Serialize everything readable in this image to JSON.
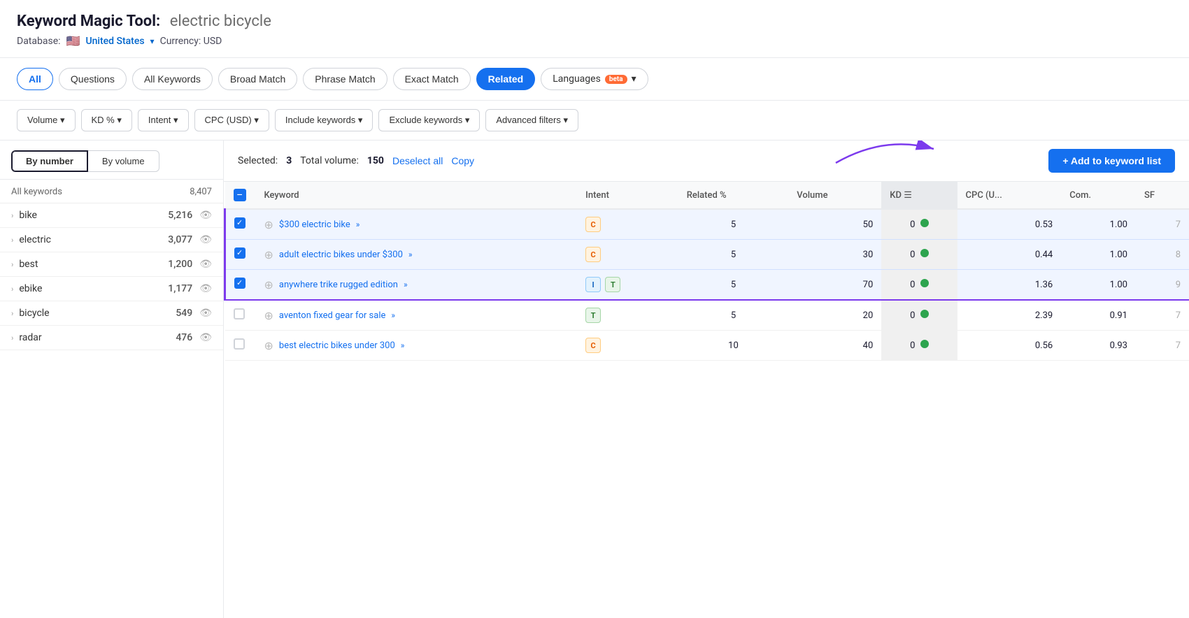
{
  "header": {
    "title_prefix": "Keyword Magic Tool:",
    "query": "electric bicycle",
    "database_label": "Database:",
    "flag": "🇺🇸",
    "country": "United States",
    "currency_label": "Currency: USD"
  },
  "tabs": [
    {
      "id": "all",
      "label": "All",
      "active": true
    },
    {
      "id": "questions",
      "label": "Questions",
      "active": false
    },
    {
      "id": "all-keywords",
      "label": "All Keywords",
      "active": false
    },
    {
      "id": "broad-match",
      "label": "Broad Match",
      "active": false
    },
    {
      "id": "phrase-match",
      "label": "Phrase Match",
      "active": false
    },
    {
      "id": "exact-match",
      "label": "Exact Match",
      "active": false
    },
    {
      "id": "related",
      "label": "Related",
      "active": false,
      "selected": true
    }
  ],
  "languages_label": "Languages",
  "filters": [
    {
      "id": "volume",
      "label": "Volume ▾"
    },
    {
      "id": "kd",
      "label": "KD % ▾"
    },
    {
      "id": "intent",
      "label": "Intent ▾"
    },
    {
      "id": "cpc",
      "label": "CPC (USD) ▾"
    },
    {
      "id": "include-keywords",
      "label": "Include keywords ▾"
    },
    {
      "id": "exclude-keywords",
      "label": "Exclude keywords ▾"
    },
    {
      "id": "advanced-filters",
      "label": "Advanced filters ▾"
    }
  ],
  "sidebar": {
    "sort_by_number": "By number",
    "sort_by_volume": "By volume",
    "all_keywords_label": "All keywords",
    "all_keywords_count": "8,407",
    "items": [
      {
        "keyword": "bike",
        "count": "5,216"
      },
      {
        "keyword": "electric",
        "count": "3,077"
      },
      {
        "keyword": "best",
        "count": "1,200"
      },
      {
        "keyword": "ebike",
        "count": "1,177"
      },
      {
        "keyword": "bicycle",
        "count": "549"
      },
      {
        "keyword": "radar",
        "count": "476"
      }
    ]
  },
  "selection_bar": {
    "selected_label": "Selected:",
    "selected_count": "3",
    "total_volume_label": "Total volume:",
    "total_volume": "150",
    "deselect_all": "Deselect all",
    "copy": "Copy",
    "add_button": "+ Add to keyword list"
  },
  "table": {
    "columns": [
      {
        "id": "checkbox",
        "label": ""
      },
      {
        "id": "keyword",
        "label": "Keyword"
      },
      {
        "id": "intent",
        "label": "Intent"
      },
      {
        "id": "related_pct",
        "label": "Related %"
      },
      {
        "id": "volume",
        "label": "Volume"
      },
      {
        "id": "kd",
        "label": "KD ☰",
        "sorted": true
      },
      {
        "id": "cpc",
        "label": "CPC (U..."
      },
      {
        "id": "com",
        "label": "Com."
      },
      {
        "id": "sf",
        "label": "SF"
      }
    ],
    "rows": [
      {
        "id": "row1",
        "selected": true,
        "keyword": "$300 electric bike",
        "intent": "C",
        "intent_type": "c",
        "related_pct": "5",
        "volume": "50",
        "kd": "0",
        "kd_dot": true,
        "cpc": "0.53",
        "com": "1.00",
        "sf": "7"
      },
      {
        "id": "row2",
        "selected": true,
        "keyword": "adult electric bikes under $300",
        "intent": "C",
        "intent_type": "c",
        "related_pct": "5",
        "volume": "30",
        "kd": "0",
        "kd_dot": true,
        "cpc": "0.44",
        "com": "1.00",
        "sf": "8"
      },
      {
        "id": "row3",
        "selected": true,
        "keyword": "anywhere trike rugged edition",
        "intent_badges": [
          "I",
          "T"
        ],
        "intent_types": [
          "i",
          "t"
        ],
        "related_pct": "5",
        "volume": "70",
        "kd": "0",
        "kd_dot": true,
        "cpc": "1.36",
        "com": "1.00",
        "sf": "9"
      },
      {
        "id": "row4",
        "selected": false,
        "keyword": "aventon fixed gear for sale",
        "intent": "T",
        "intent_type": "t",
        "related_pct": "5",
        "volume": "20",
        "kd": "0",
        "kd_dot": true,
        "cpc": "2.39",
        "com": "0.91",
        "sf": "7"
      },
      {
        "id": "row5",
        "selected": false,
        "keyword": "best electric bikes under 300",
        "intent": "C",
        "intent_type": "c",
        "related_pct": "10",
        "volume": "40",
        "kd": "0",
        "kd_dot": true,
        "cpc": "0.56",
        "com": "0.93",
        "sf": "7"
      }
    ]
  }
}
